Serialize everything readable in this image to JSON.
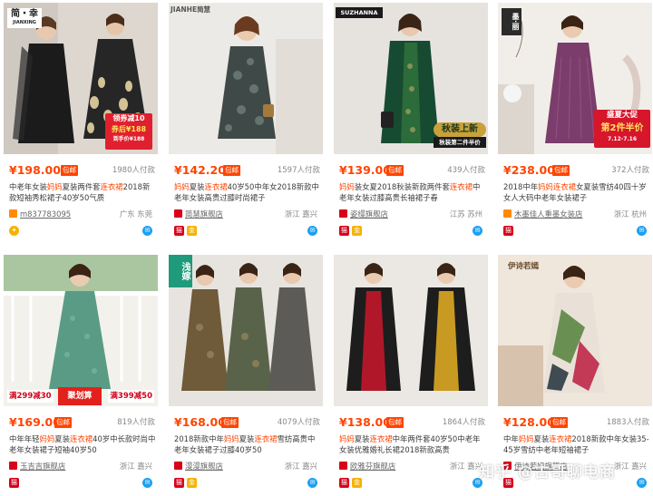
{
  "colors": {
    "accent": "#ff4400",
    "wangwang": "#1ea0f0"
  },
  "products": [
    {
      "price": "¥198.00",
      "badge": "包邮",
      "sales": "1980人付款",
      "title_parts": [
        "中老年女装",
        "妈妈",
        "夏装两件套",
        "连衣裙",
        "2018新款短袖秀松裙子40岁50气质"
      ],
      "shop": "m837783095",
      "location": "广东 东莞",
      "brand_text": "简・幸",
      "brand_sub": "JIANXING",
      "promo_line1": "领券减10",
      "promo_line2": "券后¥188",
      "promo_line3": "到手价¥188"
    },
    {
      "price": "¥142.20",
      "badge": "包邮",
      "sales": "1597人付款",
      "title_parts": [
        "妈妈",
        "夏装",
        "连衣裙",
        "40岁50中年女2018新款中老年女装高贵过膝时尚裙子"
      ],
      "shop": "简慧旗舰店",
      "location": "浙江 嘉兴",
      "brand_text": "JIANHE简慧"
    },
    {
      "price": "¥139.00",
      "badge": "包邮",
      "sales": "439人付款",
      "title_parts": [
        "妈妈",
        "装女夏2018秋装新款两件套",
        "连衣裙",
        "中老年女装过膝高贵长袖裙子春"
      ],
      "shop": "姿缦旗舰店",
      "location": "江苏 苏州",
      "brand_text": "SUZHANNA",
      "promo_line1": "秋装上新",
      "promo_line2": "秋装第二件半价"
    },
    {
      "price": "¥238.00",
      "badge": "包邮",
      "sales": "372人付款",
      "title_parts": [
        "2018中年",
        "妈妈",
        "连衣裙",
        "女夏装雪纺40四十岁女人大码中老年女装裙子"
      ],
      "shop": "木墨佳人重墨女装店",
      "location": "浙江 杭州",
      "brand_text": "墨·丽",
      "promo_line1": "盛夏大促",
      "promo_line2": "第2件半价",
      "promo_line3": "7.12-7.16"
    },
    {
      "price": "¥169.00",
      "badge": "包邮",
      "sales": "819人付款",
      "title_parts": [
        "中年年轻",
        "妈妈",
        "夏装",
        "连衣裙",
        "40岁中长款时尚中老年女装裙子短袖40岁50"
      ],
      "shop": "玉吉吉旗舰店",
      "location": "浙江 嘉兴",
      "promo_line1": "满299减30",
      "promo_line2": "聚划算",
      "promo_line3": "满399减50"
    },
    {
      "price": "¥168.00",
      "badge": "包邮",
      "sales": "4079人付款",
      "title_parts": [
        "2018新款中年",
        "妈妈",
        "夏装",
        "连衣裙",
        "雪纺高贵中老年女装裙子过膝40岁50"
      ],
      "shop": "漫漫旗舰店",
      "location": "浙江 嘉兴",
      "brand_text": "浅嫁"
    },
    {
      "price": "¥138.00",
      "badge": "包邮",
      "sales": "1864人付款",
      "title_parts": [
        "妈妈",
        "夏装",
        "连衣裙",
        "中年两件套40岁50中老年女装优雅婚礼长裙2018新款高贵"
      ],
      "shop": "欧雅芬旗舰店",
      "location": "浙江 嘉兴"
    },
    {
      "price": "¥128.00",
      "badge": "包邮",
      "sales": "1883人付款",
      "title_parts": [
        "中年",
        "妈妈",
        "夏装",
        "连衣裙",
        "2018新款中年女装35-45岁雪纺中老年短袖裙子"
      ],
      "shop": "伊诗若嫣旗舰店",
      "location": "浙江 嘉兴",
      "brand_text": "伊诗若嫣"
    }
  ],
  "watermark": "知乎 @古哥聊电商"
}
